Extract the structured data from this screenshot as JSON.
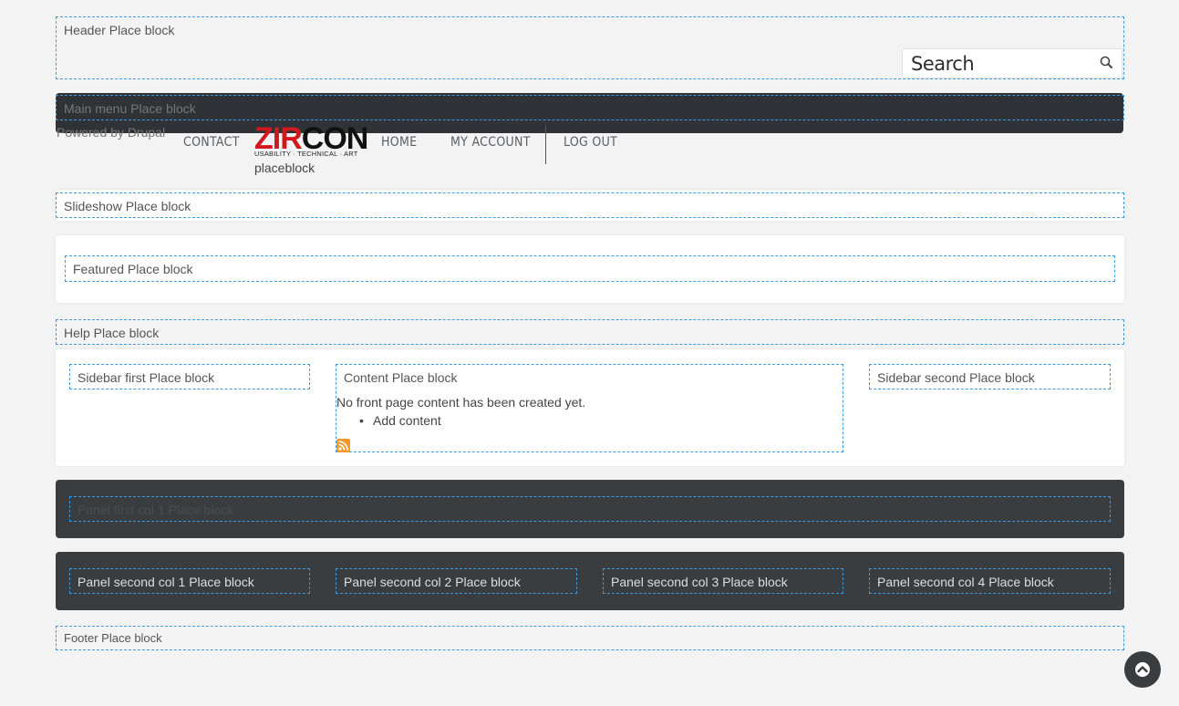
{
  "header": {
    "region_label": "Header Place block",
    "search": {
      "placeholder": "Search"
    }
  },
  "main_menu": {
    "region_label": "Main menu Place block",
    "powered_by": "Powered by Drupal",
    "items": [
      {
        "label": "CONTACT"
      },
      {
        "label": "HOME"
      },
      {
        "label": "MY ACCOUNT"
      },
      {
        "label": "LOG OUT"
      }
    ]
  },
  "logo": {
    "part1": "ZIR",
    "part2": "CON",
    "tagline": "USABILITY · TECHNICAL · ART",
    "below_label": "placeblock",
    "colors": {
      "accent": "#d0181e",
      "text": "#111111"
    }
  },
  "slideshow": {
    "region_label": "Slideshow Place block"
  },
  "featured": {
    "region_label": "Featured Place block"
  },
  "help": {
    "region_label": "Help Place block"
  },
  "sidebar_first": {
    "region_label": "Sidebar first Place block"
  },
  "content": {
    "region_label": "Content Place block",
    "message": "No front page content has been created yet.",
    "add_content_link": "Add content",
    "feed_icon": "rss-feed-icon"
  },
  "sidebar_second": {
    "region_label": "Sidebar second Place block"
  },
  "panel_first": {
    "region_label": "Panel first col 1 Place block"
  },
  "panel_second": {
    "cols": [
      {
        "label": "Panel second col 1 Place block"
      },
      {
        "label": "Panel second col 2 Place block"
      },
      {
        "label": "Panel second col 3 Place block"
      },
      {
        "label": "Panel second col 4 Place block"
      }
    ]
  },
  "footer": {
    "region_label": "Footer Place block"
  },
  "scroll_top": {
    "icon": "chevron-up-icon"
  },
  "colors": {
    "region_border": "#3b9ae0",
    "dark_panel": "#3a3d40",
    "menu_bar": "#2f3236",
    "page_bg": "#f3f3f3"
  }
}
